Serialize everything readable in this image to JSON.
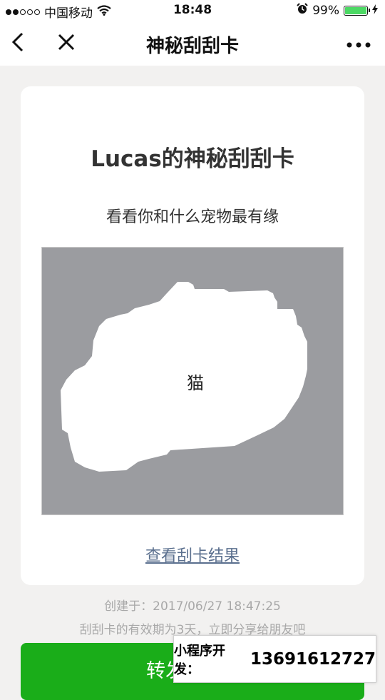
{
  "status_bar": {
    "carrier": "中国移动",
    "time": "18:48",
    "battery_percent": "99%",
    "battery_level": 0.99,
    "signal_bars_filled": 2,
    "signal_bars_total": 5,
    "icons": [
      "wifi-icon",
      "alarm-icon",
      "charging-bolt-icon"
    ]
  },
  "nav": {
    "title": "神秘刮刮卡",
    "back_icon": "chevron-left-icon",
    "close_icon": "close-icon",
    "more_icon": "more-dots-icon"
  },
  "card": {
    "title": "Lucas的神秘刮刮卡",
    "subtitle": "看看你和什么宠物最有缘",
    "prize_text": "猫",
    "result_link": "查看刮卡结果"
  },
  "meta": {
    "created": "创建于：2017/06/27 18:47:25",
    "validity": "刮刮卡的有效期为3天，立即分享给朋友吧"
  },
  "share_button": {
    "label_visible": "转发"
  },
  "developer_box": {
    "label": "小程序开发：",
    "phone": "13691612727"
  },
  "colors": {
    "page_bg": "#f2f1f0",
    "scratch_cover": "#9b9ca0",
    "link": "#5a6f8e",
    "primary_green": "#1aad19",
    "battery_green": "#4cd964"
  }
}
